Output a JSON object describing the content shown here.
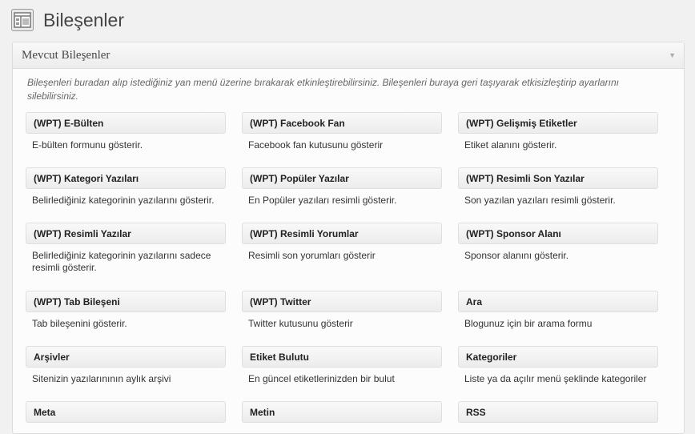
{
  "page": {
    "title": "Bileşenler"
  },
  "panel": {
    "title": "Mevcut Bileşenler",
    "description": "Bileşenleri buradan alıp istediğiniz yan menü üzerine bırakarak etkinleştirebilirsiniz. Bileşenleri buraya geri taşıyarak etkisizleştirip ayarlarını silebilirsiniz."
  },
  "widgets": [
    {
      "title": "(WPT) E-Bülten",
      "desc": "E-bülten formunu gösterir."
    },
    {
      "title": "(WPT) Facebook Fan",
      "desc": "Facebook fan kutusunu gösterir"
    },
    {
      "title": "(WPT) Gelişmiş Etiketler",
      "desc": "Etiket alanını gösterir."
    },
    {
      "title": "(WPT) Kategori Yazıları",
      "desc": "Belirlediğiniz kategorinin yazılarını gösterir."
    },
    {
      "title": "(WPT) Popüler Yazılar",
      "desc": "En Popüler yazıları resimli gösterir."
    },
    {
      "title": "(WPT) Resimli Son Yazılar",
      "desc": "Son yazılan yazıları resimli gösterir."
    },
    {
      "title": "(WPT) Resimli Yazılar",
      "desc": "Belirlediğiniz kategorinin yazılarını sadece resimli gösterir."
    },
    {
      "title": "(WPT) Resimli Yorumlar",
      "desc": "Resimli son yorumları gösterir"
    },
    {
      "title": "(WPT) Sponsor Alanı",
      "desc": "Sponsor alanını gösterir."
    },
    {
      "title": "(WPT) Tab Bileşeni",
      "desc": "Tab bileşenini gösterir."
    },
    {
      "title": "(WPT) Twitter",
      "desc": "Twitter kutusunu gösterir"
    },
    {
      "title": "Ara",
      "desc": "Blogunuz için bir arama formu"
    },
    {
      "title": "Arşivler",
      "desc": "Sitenizin yazılarınının aylık arşivi"
    },
    {
      "title": "Etiket Bulutu",
      "desc": "En güncel etiketlerinizden bir bulut"
    },
    {
      "title": "Kategoriler",
      "desc": "Liste ya da açılır menü şeklinde kategoriler"
    },
    {
      "title": "Meta",
      "desc": ""
    },
    {
      "title": "Metin",
      "desc": ""
    },
    {
      "title": "RSS",
      "desc": ""
    }
  ]
}
